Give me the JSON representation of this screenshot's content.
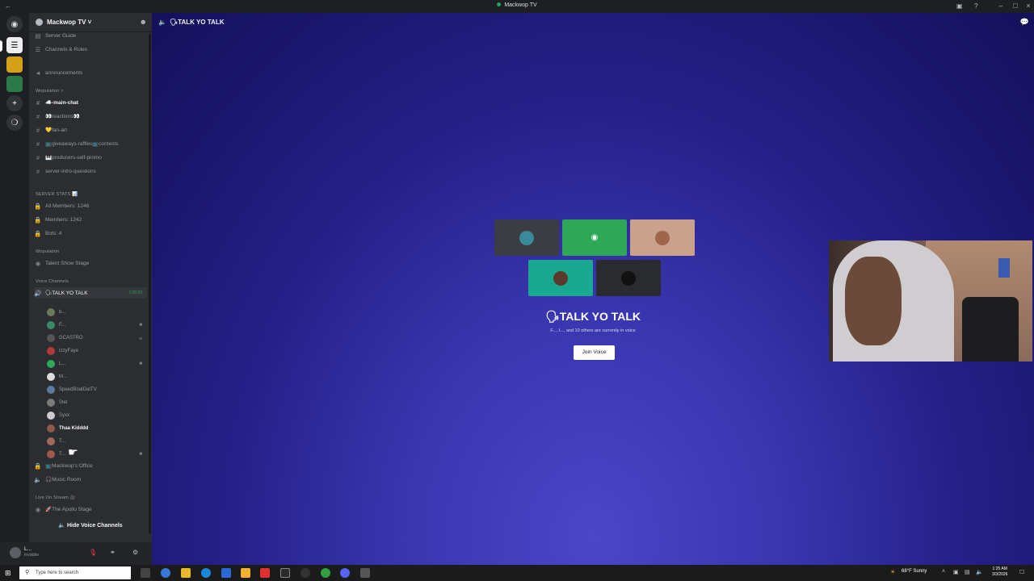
{
  "window": {
    "title": "Mackwop TV"
  },
  "server": {
    "name": "Mackwop TV"
  },
  "sidebar": {
    "top_items": [
      {
        "label": "Server Guide",
        "icon": "server-guide-icon"
      },
      {
        "label": "Channels & Roles",
        "icon": "channels-roles-icon"
      }
    ],
    "announcements": "announcements",
    "category_1": "Wopulation",
    "text_channels": [
      {
        "label": "☁️-main-chat",
        "active": true
      },
      {
        "label": "👀reactions👀"
      },
      {
        "label": "💛fan-art"
      },
      {
        "label": "📺giveaways-raffles📺contests"
      },
      {
        "label": "🎹producers-self-promo"
      },
      {
        "label": "server-intro-questions"
      }
    ],
    "stats_category": "SERVER STATS 📊",
    "stats": [
      "All Members: 1246",
      "Members: 1242",
      "Bots: 4"
    ],
    "category_2": "Wopulation",
    "stage": "Talent Show Stage",
    "voice_category": "Voice Channels",
    "voice_channel": {
      "label": "🗣TALK YO TALK",
      "timer": "2:26:33"
    },
    "voice_users": [
      {
        "name": "b...",
        "color": "#6a7a5a",
        "cam": false
      },
      {
        "name": "F...",
        "color": "#3a8a6a",
        "cam": true
      },
      {
        "name": "GCASTRO",
        "color": "#555555",
        "cam": false,
        "muted": true
      },
      {
        "name": "IzzyFaye",
        "color": "#b03a3a",
        "cam": false
      },
      {
        "name": "L...",
        "color": "#2faa5a",
        "cam": true
      },
      {
        "name": "M...",
        "color": "#dddddd",
        "cam": false
      },
      {
        "name": "SpeedBoatDatTV",
        "color": "#5a7aa0",
        "cam": false
      },
      {
        "name": "Stel",
        "color": "#7a7a7a",
        "cam": false
      },
      {
        "name": "Syxx",
        "color": "#cccccc",
        "cam": false
      },
      {
        "name": "Thaa Kidddd",
        "color": "#8a5a4a",
        "cam": false,
        "highlight": true
      },
      {
        "name": "T...",
        "color": "#a06a5a",
        "cam": false
      },
      {
        "name": "T...",
        "color": "#a05a4a",
        "cam": true
      }
    ],
    "office": "📺Mackwop's Office",
    "music": "🎧Music Room",
    "live_category": "Live On Stream 🎥",
    "apollo": "🚀The Apollo Stage",
    "hide_voice": "Hide Voice Channels"
  },
  "user_panel": {
    "name": "L...",
    "status": "Invisible"
  },
  "main": {
    "channel_title": "🗣TALK YO TALK",
    "voice_title": "🗣TALK YO TALK",
    "voice_subtitle": "F..., I..., and 10 others are currently in voice",
    "join_button": "Join Voice",
    "tiles": [
      {
        "color": "#3a3d42",
        "avatar": "#3a8a9a"
      },
      {
        "color": "#2ea858",
        "avatar": "discord-logo"
      },
      {
        "color": "#c9a28e",
        "avatar": "#a0644a"
      },
      {
        "color": "#1aa890",
        "avatar": "#5a3a2a"
      },
      {
        "color": "#2a2b2e",
        "avatar": "#111111"
      }
    ]
  },
  "taskbar": {
    "search_placeholder": "Type here to search",
    "weather": "68°F Sunny",
    "time": "1:25 AM",
    "date": "3/3/2026"
  },
  "colors": {
    "accent_green": "#23a55a",
    "background_blue": "#241f86"
  }
}
